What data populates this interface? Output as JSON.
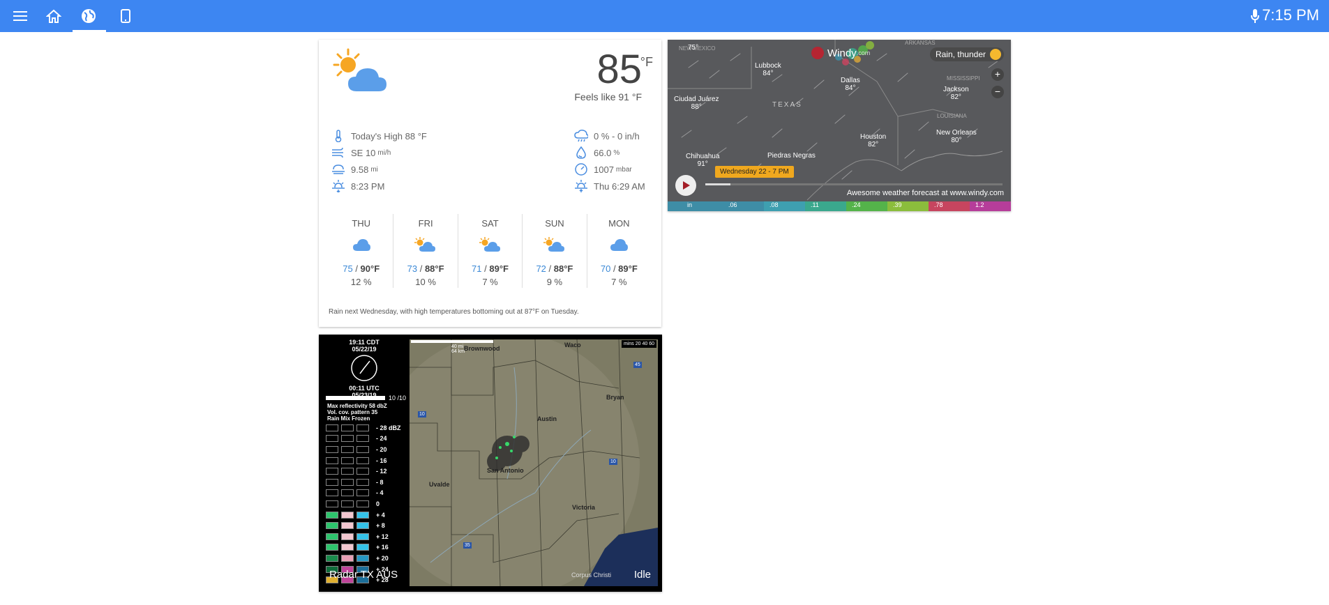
{
  "topbar": {
    "icons": [
      "menu-icon",
      "home-icon",
      "globe-icon",
      "phone-icon",
      "mic-icon"
    ],
    "time": "7:15 PM",
    "bg_color": "#3d86f2"
  },
  "weather": {
    "temperature": "85",
    "unit": "°F",
    "feels_like": "Feels like 91 °F",
    "left_details": [
      {
        "icon": "thermometer-icon",
        "text": "Today's High 88 °F",
        "unit": ""
      },
      {
        "icon": "wind-icon",
        "text": "SE 10",
        "unit": "mi/h"
      },
      {
        "icon": "visibility-icon",
        "text": "9.58",
        "unit": "mi"
      },
      {
        "icon": "sunset-icon",
        "text": "8:23 PM",
        "unit": ""
      }
    ],
    "right_details": [
      {
        "icon": "precipitation-icon",
        "text": "0 % - 0 in/h",
        "unit": ""
      },
      {
        "icon": "humidity-icon",
        "text": "66.0",
        "unit": "%"
      },
      {
        "icon": "pressure-icon",
        "text": "1007",
        "unit": "mbar"
      },
      {
        "icon": "sunrise-icon",
        "text": "Thu 6:29 AM",
        "unit": ""
      }
    ],
    "forecast": [
      {
        "day": "THU",
        "icon": "cloud-icon",
        "low": "75",
        "high": "90°F",
        "precip": "12 %"
      },
      {
        "day": "FRI",
        "icon": "partly-sunny-icon",
        "low": "73",
        "high": "88°F",
        "precip": "10 %"
      },
      {
        "day": "SAT",
        "icon": "partly-sunny-icon",
        "low": "71",
        "high": "89°F",
        "precip": "7 %"
      },
      {
        "day": "SUN",
        "icon": "partly-sunny-icon",
        "low": "72",
        "high": "88°F",
        "precip": "9 %"
      },
      {
        "day": "MON",
        "icon": "cloud-icon",
        "low": "70",
        "high": "89°F",
        "precip": "7 %"
      }
    ],
    "summary": "Rain next Wednesday, with high temperatures bottoming out at 87°F on Tuesday."
  },
  "windy": {
    "brand": "Windy",
    "brand_suffix": ".com",
    "layer_label": "Rain, thunder",
    "timeline_label": "Wednesday 22 - 7 PM",
    "footer": "Awesome weather forecast at www.windy.com",
    "cities": [
      {
        "name": "Lubbock",
        "temp": "84°"
      },
      {
        "name": "Dallas",
        "temp": "84°"
      },
      {
        "name": "Jackson",
        "temp": "82°"
      },
      {
        "name": "Ciudad Juárez",
        "temp": "88°"
      },
      {
        "name": "Houston",
        "temp": "82°"
      },
      {
        "name": "New Orleans",
        "temp": "80°"
      },
      {
        "name": "Chihuahua",
        "temp": "91°"
      },
      {
        "name": "Piedras Negras",
        "temp": ""
      },
      {
        "name": "",
        "temp": "75°"
      }
    ],
    "regions": [
      "TEXAS",
      "MISSISSIPPI",
      "LOUISIANA",
      "ARKANSAS",
      "NEW MEXICO"
    ],
    "scale": [
      "in",
      ".06",
      ".08",
      ".11",
      ".24",
      ".39",
      ".78",
      "1.2"
    ],
    "scale_colors": [
      "#3e8da6",
      "#3e8da6",
      "#3e9fb0",
      "#3aa88d",
      "#54b34a",
      "#8bbd3c",
      "#d6a53a",
      "#c7455f",
      "#b63d9a"
    ]
  },
  "radar": {
    "time_local": "19:11 CDT",
    "date_local": "05/22/19",
    "time_utc": "00:11 UTC",
    "date_utc": "05/23/19",
    "progress": "10 /10",
    "max_reflectivity": "Max reflectivity 58 dbZ",
    "vol_cov": "Vol. cov. pattern 35",
    "legend_header": "Rain Mix Frozen",
    "levels": [
      "- 28 dBZ",
      "- 24",
      "- 20",
      "- 16",
      "- 12",
      "- 8",
      "- 4",
      "0",
      "+ 4",
      "+ 8",
      "+ 12",
      "+ 16",
      "+ 20",
      "+ 24",
      "+ 28"
    ],
    "scale_label": "40 mi\n64 km",
    "speed_label": "mins 20 40 60",
    "cities": [
      "Brownwood",
      "Waco",
      "Austin",
      "Bryan",
      "San Antonio",
      "Uvalde",
      "Victoria",
      "Corpus Christi"
    ],
    "title": "Radar TX AUS",
    "status": "Idle",
    "highways": [
      "10",
      "45",
      "10",
      "35",
      "10"
    ]
  }
}
